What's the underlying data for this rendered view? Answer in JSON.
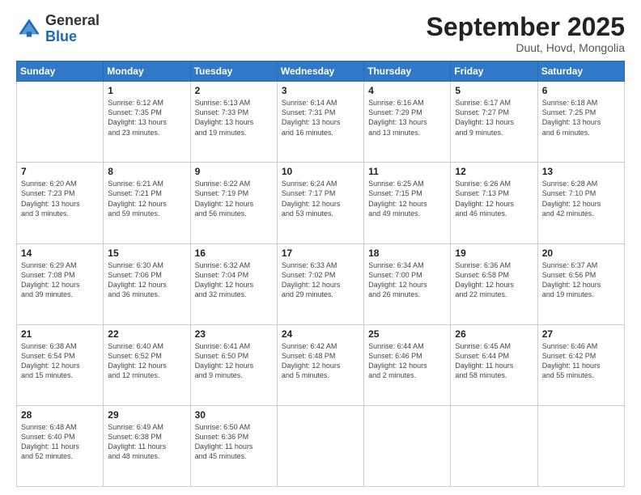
{
  "header": {
    "logo_general": "General",
    "logo_blue": "Blue",
    "month_title": "September 2025",
    "subtitle": "Duut, Hovd, Mongolia"
  },
  "days_of_week": [
    "Sunday",
    "Monday",
    "Tuesday",
    "Wednesday",
    "Thursday",
    "Friday",
    "Saturday"
  ],
  "weeks": [
    [
      {
        "day": "",
        "info": ""
      },
      {
        "day": "1",
        "info": "Sunrise: 6:12 AM\nSunset: 7:35 PM\nDaylight: 13 hours\nand 23 minutes."
      },
      {
        "day": "2",
        "info": "Sunrise: 6:13 AM\nSunset: 7:33 PM\nDaylight: 13 hours\nand 19 minutes."
      },
      {
        "day": "3",
        "info": "Sunrise: 6:14 AM\nSunset: 7:31 PM\nDaylight: 13 hours\nand 16 minutes."
      },
      {
        "day": "4",
        "info": "Sunrise: 6:16 AM\nSunset: 7:29 PM\nDaylight: 13 hours\nand 13 minutes."
      },
      {
        "day": "5",
        "info": "Sunrise: 6:17 AM\nSunset: 7:27 PM\nDaylight: 13 hours\nand 9 minutes."
      },
      {
        "day": "6",
        "info": "Sunrise: 6:18 AM\nSunset: 7:25 PM\nDaylight: 13 hours\nand 6 minutes."
      }
    ],
    [
      {
        "day": "7",
        "info": "Sunrise: 6:20 AM\nSunset: 7:23 PM\nDaylight: 13 hours\nand 3 minutes."
      },
      {
        "day": "8",
        "info": "Sunrise: 6:21 AM\nSunset: 7:21 PM\nDaylight: 12 hours\nand 59 minutes."
      },
      {
        "day": "9",
        "info": "Sunrise: 6:22 AM\nSunset: 7:19 PM\nDaylight: 12 hours\nand 56 minutes."
      },
      {
        "day": "10",
        "info": "Sunrise: 6:24 AM\nSunset: 7:17 PM\nDaylight: 12 hours\nand 53 minutes."
      },
      {
        "day": "11",
        "info": "Sunrise: 6:25 AM\nSunset: 7:15 PM\nDaylight: 12 hours\nand 49 minutes."
      },
      {
        "day": "12",
        "info": "Sunrise: 6:26 AM\nSunset: 7:13 PM\nDaylight: 12 hours\nand 46 minutes."
      },
      {
        "day": "13",
        "info": "Sunrise: 6:28 AM\nSunset: 7:10 PM\nDaylight: 12 hours\nand 42 minutes."
      }
    ],
    [
      {
        "day": "14",
        "info": "Sunrise: 6:29 AM\nSunset: 7:08 PM\nDaylight: 12 hours\nand 39 minutes."
      },
      {
        "day": "15",
        "info": "Sunrise: 6:30 AM\nSunset: 7:06 PM\nDaylight: 12 hours\nand 36 minutes."
      },
      {
        "day": "16",
        "info": "Sunrise: 6:32 AM\nSunset: 7:04 PM\nDaylight: 12 hours\nand 32 minutes."
      },
      {
        "day": "17",
        "info": "Sunrise: 6:33 AM\nSunset: 7:02 PM\nDaylight: 12 hours\nand 29 minutes."
      },
      {
        "day": "18",
        "info": "Sunrise: 6:34 AM\nSunset: 7:00 PM\nDaylight: 12 hours\nand 26 minutes."
      },
      {
        "day": "19",
        "info": "Sunrise: 6:36 AM\nSunset: 6:58 PM\nDaylight: 12 hours\nand 22 minutes."
      },
      {
        "day": "20",
        "info": "Sunrise: 6:37 AM\nSunset: 6:56 PM\nDaylight: 12 hours\nand 19 minutes."
      }
    ],
    [
      {
        "day": "21",
        "info": "Sunrise: 6:38 AM\nSunset: 6:54 PM\nDaylight: 12 hours\nand 15 minutes."
      },
      {
        "day": "22",
        "info": "Sunrise: 6:40 AM\nSunset: 6:52 PM\nDaylight: 12 hours\nand 12 minutes."
      },
      {
        "day": "23",
        "info": "Sunrise: 6:41 AM\nSunset: 6:50 PM\nDaylight: 12 hours\nand 9 minutes."
      },
      {
        "day": "24",
        "info": "Sunrise: 6:42 AM\nSunset: 6:48 PM\nDaylight: 12 hours\nand 5 minutes."
      },
      {
        "day": "25",
        "info": "Sunrise: 6:44 AM\nSunset: 6:46 PM\nDaylight: 12 hours\nand 2 minutes."
      },
      {
        "day": "26",
        "info": "Sunrise: 6:45 AM\nSunset: 6:44 PM\nDaylight: 11 hours\nand 58 minutes."
      },
      {
        "day": "27",
        "info": "Sunrise: 6:46 AM\nSunset: 6:42 PM\nDaylight: 11 hours\nand 55 minutes."
      }
    ],
    [
      {
        "day": "28",
        "info": "Sunrise: 6:48 AM\nSunset: 6:40 PM\nDaylight: 11 hours\nand 52 minutes."
      },
      {
        "day": "29",
        "info": "Sunrise: 6:49 AM\nSunset: 6:38 PM\nDaylight: 11 hours\nand 48 minutes."
      },
      {
        "day": "30",
        "info": "Sunrise: 6:50 AM\nSunset: 6:36 PM\nDaylight: 11 hours\nand 45 minutes."
      },
      {
        "day": "",
        "info": ""
      },
      {
        "day": "",
        "info": ""
      },
      {
        "day": "",
        "info": ""
      },
      {
        "day": "",
        "info": ""
      }
    ]
  ]
}
